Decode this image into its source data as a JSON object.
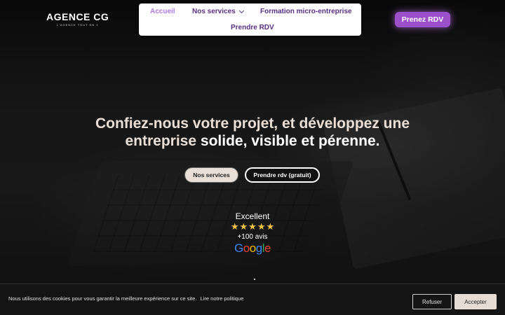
{
  "brand": {
    "name": "AGENCE CG",
    "tagline": "L'AGENCE TOUT EN 1"
  },
  "nav": {
    "items": [
      {
        "label": "Accueil",
        "active": true
      },
      {
        "label": "Nos services",
        "has_dropdown": true
      },
      {
        "label": "Formation micro-entreprise"
      },
      {
        "label": "Prendre RDV"
      }
    ]
  },
  "header_cta": "Prenez RDV",
  "hero": {
    "title_part1": "Confiez-nous votre projet, et développez une",
    "title_part2": "entreprise",
    "title_part3": "solide, visible et pérenne."
  },
  "buttons": {
    "services": "Nos services",
    "rdv": "Prendre rdv (gratuit)"
  },
  "review": {
    "label": "Excellent",
    "stars": 5,
    "count": "+100 avis",
    "provider": "Google"
  },
  "cookie": {
    "text": "Nous utilisons des cookies pour vous garantir la meilleure expérience sur ce site.",
    "link": "Lire notre politique",
    "refuse": "Refuser",
    "accept": "Accepter"
  },
  "colors": {
    "accent_purple": "#9b4fc9",
    "nav_text": "#5a2d82",
    "nav_active": "#b477e0",
    "cream": "#e9dfd6"
  }
}
